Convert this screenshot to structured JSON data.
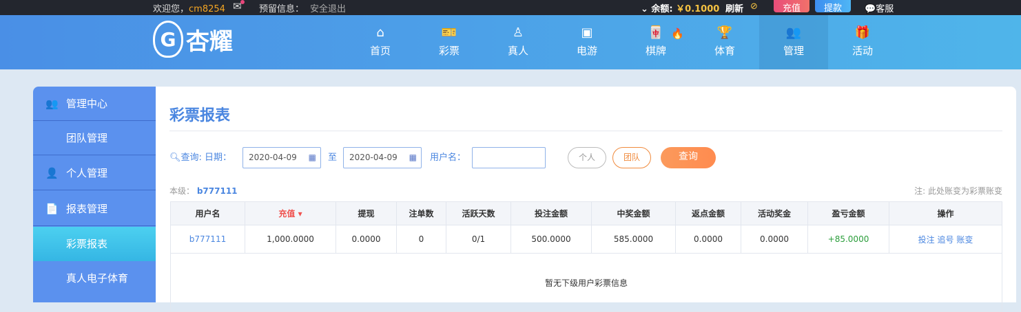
{
  "topbar": {
    "welcome": "欢迎您，",
    "username": "cm8254",
    "reserved": "预留信息：",
    "logout": "安全退出",
    "balance_label": "余额:",
    "balance": "￥0.1000",
    "refresh": "刷新",
    "deposit": "充值",
    "withdraw": "提款",
    "service": "客服"
  },
  "logo": "杏耀",
  "nav": [
    {
      "label": "首页",
      "icon": "⌂"
    },
    {
      "label": "彩票",
      "icon": "🎫"
    },
    {
      "label": "真人",
      "icon": "♙"
    },
    {
      "label": "电游",
      "icon": "▣"
    },
    {
      "label": "棋牌",
      "icon": "🀄"
    },
    {
      "label": "体育",
      "icon": "🏆"
    },
    {
      "label": "管理",
      "icon": "👥"
    },
    {
      "label": "活动",
      "icon": "🎁"
    }
  ],
  "sidebar": [
    {
      "label": "管理中心"
    },
    {
      "label": "团队管理"
    },
    {
      "label": "个人管理"
    },
    {
      "label": "报表管理"
    },
    {
      "label": "彩票报表"
    },
    {
      "label": "真人电子体育"
    }
  ],
  "main": {
    "title": "彩票报表",
    "query": "查询:",
    "date_label": "日期：",
    "date_from": "2020-04-09",
    "to": "至",
    "date_to": "2020-04-09",
    "user_label": "用户名：",
    "user_value": "",
    "btn_personal": "个人",
    "btn_team": "团队",
    "btn_query": "查询",
    "level_label": "本级：",
    "level_user": "b777111",
    "note": "注: 此处账变为彩票账变"
  },
  "table": {
    "headers": [
      "用户名",
      "充值",
      "提现",
      "注单数",
      "活跃天数",
      "投注金额",
      "中奖金额",
      "返点金额",
      "活动奖金",
      "盈亏金额",
      "操作"
    ],
    "rows": [
      [
        "b777111",
        "1,000.0000",
        "0.0000",
        "0",
        "0/1",
        "500.0000",
        "585.0000",
        "0.0000",
        "0.0000",
        "+85.0000"
      ]
    ],
    "actions": [
      "投注",
      "追号",
      "账变"
    ],
    "empty": "暂无下级用户彩票信息"
  }
}
